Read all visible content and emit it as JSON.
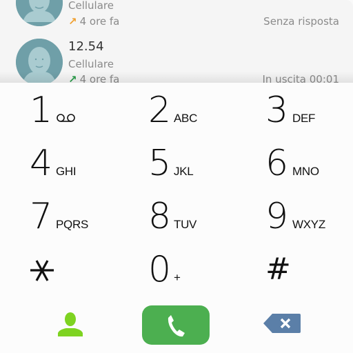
{
  "call_log": {
    "entries": [
      {
        "name": "",
        "type": "Cellulare",
        "direction_icon": "outgoing-arrow-icon",
        "direction_color": "#f0a030",
        "time": "4 ore fa",
        "status": "Senza risposta"
      },
      {
        "name": "12.54",
        "type": "Cellulare",
        "direction_icon": "outgoing-arrow-icon",
        "direction_color": "#2a9d4a",
        "time": "4 ore fa",
        "status": "In uscita 00:01"
      }
    ]
  },
  "dialpad": {
    "keys": [
      {
        "digit": "1",
        "letters": "",
        "icon": "voicemail-icon"
      },
      {
        "digit": "2",
        "letters": "ABC"
      },
      {
        "digit": "3",
        "letters": "DEF"
      },
      {
        "digit": "4",
        "letters": "GHI"
      },
      {
        "digit": "5",
        "letters": "JKL"
      },
      {
        "digit": "6",
        "letters": "MNO"
      },
      {
        "digit": "7",
        "letters": "PQRS"
      },
      {
        "digit": "8",
        "letters": "TUV"
      },
      {
        "digit": "9",
        "letters": "WXYZ"
      },
      {
        "digit": "*",
        "letters": ""
      },
      {
        "digit": "0",
        "letters": "+"
      },
      {
        "digit": "#",
        "letters": ""
      }
    ]
  },
  "actions": {
    "contacts_icon": "person-icon",
    "call_icon": "phone-icon",
    "delete_icon": "backspace-icon",
    "contacts_color": "#7ed321",
    "call_color": "#4caf50",
    "delete_color": "#5b7fa8"
  }
}
